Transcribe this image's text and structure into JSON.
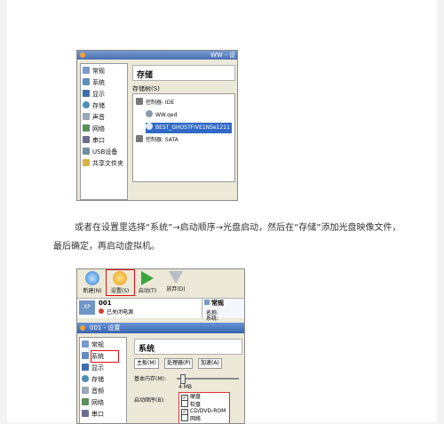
{
  "shot1": {
    "window_title": "WW - 设",
    "sidebar": [
      "常规",
      "系统",
      "显示",
      "存储",
      "声音",
      "网络",
      "串口",
      "USB设备",
      "共享文件夹"
    ],
    "section_title": "存储",
    "tree_label": "存储树(S)",
    "tree": [
      {
        "label": "控制器: IDE",
        "level": 0
      },
      {
        "label": "WW.qed",
        "level": 1
      },
      {
        "label": "BEST_GHOSTFIVE1NSe1211",
        "level": 1
      },
      {
        "label": "控制器: SATA",
        "level": 0
      }
    ]
  },
  "paragraph": "或者在设置里选择“系统”→启动顺序→光盘启动，然后在“存储”添加光盘映像文件，最后确定，再启动虚拟机。",
  "shot2": {
    "toolbar": [
      {
        "label": "新建(N)",
        "icon": "new-icon"
      },
      {
        "label": "设置(S)",
        "icon": "settings-gear-icon"
      },
      {
        "label": "启动(T)",
        "icon": "start-arrow-icon"
      },
      {
        "label": "放弃(D)",
        "icon": "discard-arrow-icon"
      }
    ],
    "vm": {
      "name": "001",
      "status": "已关闭电源",
      "badge": "XP"
    },
    "details": {
      "title": "常规",
      "name_label": "名称:",
      "os_label": "系统:"
    },
    "dialog_title": "001 - 设置",
    "sidebar": [
      "常规",
      "系统",
      "显示",
      "存储",
      "音频",
      "网络",
      "串口"
    ],
    "section_title": "系统",
    "tabs": [
      "主板(M)",
      "处理器(P)",
      "加速(A)"
    ],
    "memory_label": "基本内存(M):",
    "memory_value": "4 MB",
    "boot_label": "启动顺序(B):",
    "boot_order": [
      {
        "label": "硬盘",
        "checked": true
      },
      {
        "label": "软盘",
        "checked": false
      },
      {
        "label": "CD/DVD-ROM",
        "checked": true
      },
      {
        "label": "网络",
        "checked": false
      }
    ]
  }
}
